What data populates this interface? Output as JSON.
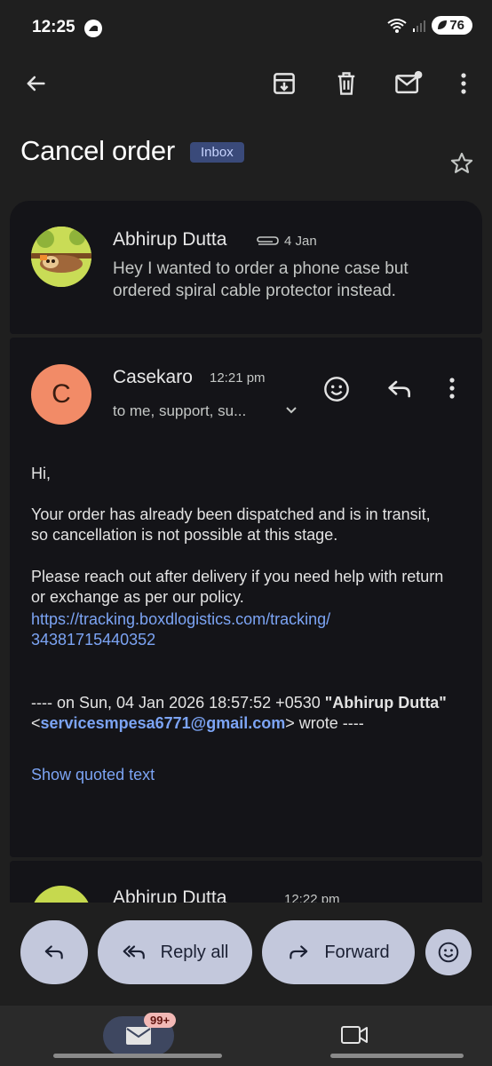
{
  "status_bar": {
    "time": "12:25",
    "battery": "76"
  },
  "toolbar": {
    "back_icon": "arrow-left-icon",
    "archive_icon": "archive-icon",
    "delete_icon": "trash-icon",
    "mark_unread_icon": "mail-unread-icon",
    "more_icon": "more-vert-icon"
  },
  "subject": {
    "title": "Cancel order",
    "label_chip": "Inbox"
  },
  "thread": [
    {
      "sender": "Abhirup Dutta",
      "date": "4 Jan",
      "has_attachment": true,
      "snippet": "Hey I wanted to order a phone case but ordered spiral cable protector instead."
    },
    {
      "sender": "Casekaro",
      "avatar_letter": "C",
      "time": "12:21 pm",
      "recipients": "to me, support, su...",
      "body": {
        "greeting": "Hi,",
        "paragraph1": "Your order has already been dispatched and is in transit, so cancellation is not possible at this stage.",
        "paragraph2": "Please reach out after delivery if you need help with return or exchange as per our policy.",
        "link_line1": "https://tracking.boxdlogistics.com/tracking/",
        "link_line2": "34381715440352",
        "quote_prefix": "---- on Sun, 04 Jan 2026 18:57:52 +0530 ",
        "quote_name": "\"Abhirup Dutta\"",
        "quote_lt": "<",
        "quote_email": "servicesmpesa6771@gmail.com",
        "quote_suffix": "> wrote ----",
        "show_quoted": "Show quoted text"
      }
    },
    {
      "sender": "Abhirup Dutta",
      "time": "12:22 pm"
    }
  ],
  "actions": {
    "reply_all": "Reply all",
    "forward": "Forward"
  },
  "nav": {
    "mail_badge": "99+"
  },
  "colors": {
    "background": "#1f1f1f",
    "card": "#141418",
    "link": "#7ca4f4",
    "pill": "#c3c8dc",
    "avatar_c": "#f28b67"
  }
}
